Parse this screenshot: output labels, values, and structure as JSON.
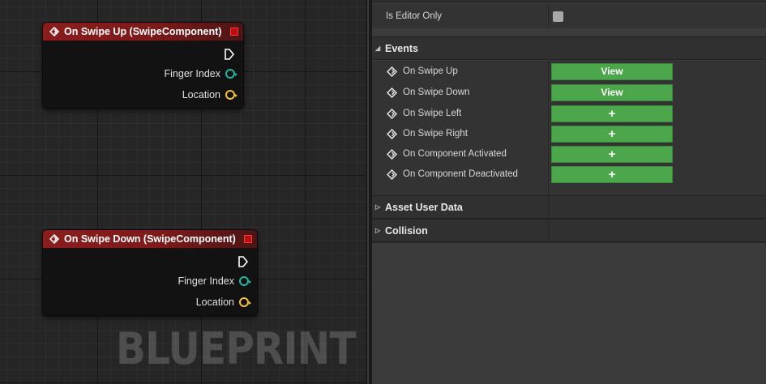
{
  "graph": {
    "watermark": "BLUEPRINT",
    "nodes": [
      {
        "title": "On Swipe Up (SwipeComponent)",
        "pins": [
          {
            "label": "Finger Index",
            "type": "int"
          },
          {
            "label": "Location",
            "type": "vector"
          }
        ]
      },
      {
        "title": "On Swipe Down (SwipeComponent)",
        "pins": [
          {
            "label": "Finger Index",
            "type": "int"
          },
          {
            "label": "Location",
            "type": "vector"
          }
        ]
      }
    ]
  },
  "details": {
    "properties": [
      {
        "label": "Is Editor Only",
        "checked": false
      }
    ],
    "events_category": "Events",
    "events": [
      {
        "label": "On Swipe Up",
        "button": "View"
      },
      {
        "label": "On Swipe Down",
        "button": "View"
      },
      {
        "label": "On Swipe Left",
        "button": "+"
      },
      {
        "label": "On Swipe Right",
        "button": "+"
      },
      {
        "label": "On Component Activated",
        "button": "+"
      },
      {
        "label": "On Component Deactivated",
        "button": "+"
      }
    ],
    "categories": [
      {
        "label": "Asset User Data",
        "expanded": false
      },
      {
        "label": "Collision",
        "expanded": false
      }
    ]
  },
  "colors": {
    "event_header": "#8a1c1c",
    "int_pin": "#1fb7a0",
    "vector_pin": "#f6c531",
    "event_button": "#4ca64c"
  }
}
